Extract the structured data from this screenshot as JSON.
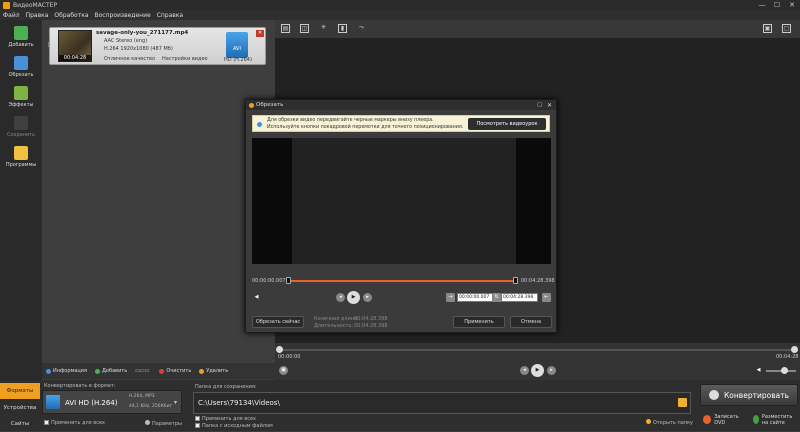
{
  "titlebar": {
    "title": "ВидеоМАСТЕР",
    "min": "—",
    "max": "☐",
    "close": "✕"
  },
  "menu": [
    "Файл",
    "Правка",
    "Обработка",
    "Воспроизведение",
    "Справка"
  ],
  "sidebar": [
    {
      "label": "Добавить",
      "color": "#4caf50"
    },
    {
      "label": "Обрезать",
      "color": "#4a90d9"
    },
    {
      "label": "Эффекты",
      "color": "#7cb342"
    },
    {
      "label": "Сохранить",
      "color": "#555555"
    },
    {
      "label": "Программы",
      "color": "#f0c040"
    }
  ],
  "file": {
    "name": "savage-only-you_271177.mp4",
    "audio": "AAC Stereo (eng)",
    "video": "H.264 1920x1080 (487 Мб)",
    "duration": "00:04:28",
    "quality": "Отличное качество",
    "settings": "Настройки видео",
    "target_badge": "AVI",
    "target_format": "HD (H.264)"
  },
  "left_toolbar": {
    "info": "Информация",
    "add": "Добавить",
    "clear": "Очистить",
    "delete": "Удалить"
  },
  "dialog": {
    "title": "Обрезать",
    "info_line1": "Для обрезки видео передвигайте черные маркеры внизу плеера.",
    "info_line2": "Используйте кнопки покадровой перемотки для точного позиционирования.",
    "watch_btn": "Посмотреть видеоурок",
    "time_start": "00:00:00.007",
    "time_end": "00:04:28.398",
    "input_start": "00:00:00.007",
    "input_end": "00:04:28.398",
    "trim_now": "Обрезать сейчас",
    "final_len_label": "Конечная длина:",
    "final_len": "00:04:28.398",
    "source_len_label": "Длительность:",
    "source_len": "00:04:28.398",
    "apply": "Применить",
    "cancel": "Отмена"
  },
  "player": {
    "time_start": "00:00:00",
    "time_end": "00:04:28",
    "volume": 0.6
  },
  "bottom": {
    "tab_formats": "Форматы",
    "tab_devices": "Устройства",
    "tab_sites": "Сайты",
    "convert_label": "Конвертировать в формат:",
    "format_name": "AVI HD (H.264)",
    "format_detail1": "H.264, MP3",
    "format_detail2": "44,1 KHz, 256Кбит",
    "apply_all": "Применить для всех",
    "params": "Параметры",
    "save_folder_label": "Папка для сохранения:",
    "save_path": "C:\\Users\\79134\\Videos\\",
    "apply_all2": "Применить для всех",
    "source_folder": "Папка с исходным файлом",
    "open_folder": "Открыть папку",
    "convert": "Конвертировать",
    "burn_dvd": "Записать DVD",
    "upload": "Разместить на сайте"
  }
}
